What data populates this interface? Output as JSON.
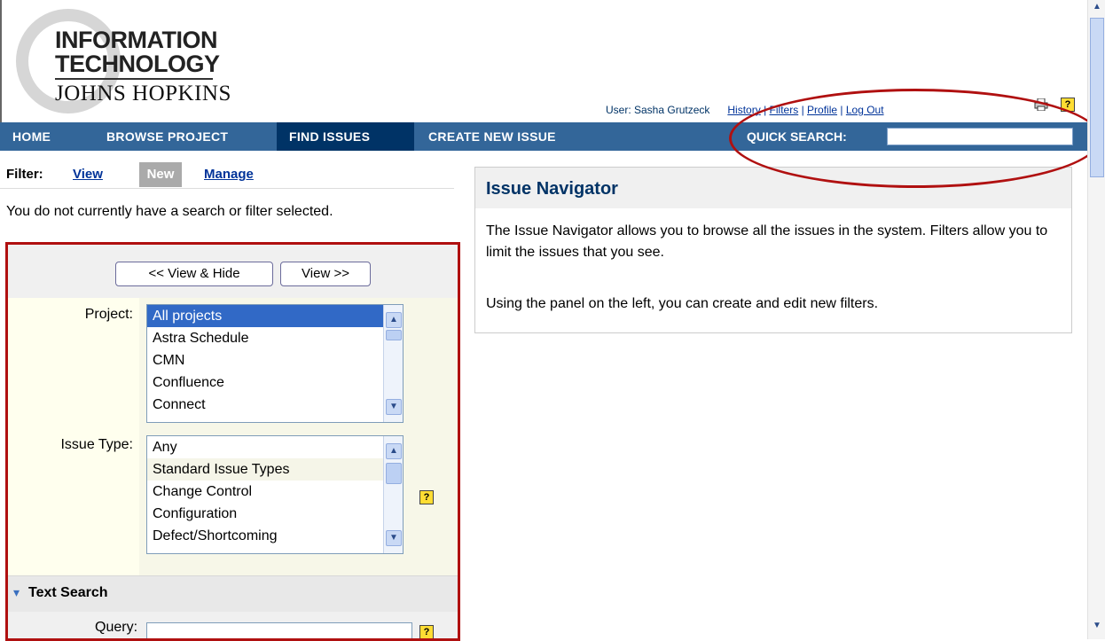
{
  "logo": {
    "line1": "INFORMATION",
    "line2": "TECHNOLOGY",
    "line3": "JOHNS HOPKINS"
  },
  "user_bar": {
    "user_text": "User: Sasha Grutzeck",
    "links": [
      "History",
      "Filters",
      "Profile",
      "Log Out"
    ],
    "sep": "|"
  },
  "nav": {
    "items": [
      "HOME",
      "BROWSE PROJECT",
      "FIND ISSUES",
      "CREATE NEW ISSUE"
    ],
    "active": "FIND ISSUES",
    "quick_search_label": "QUICK SEARCH:",
    "quick_search_value": ""
  },
  "filter": {
    "label": "Filter:",
    "view": "View",
    "new": "New",
    "manage": "Manage",
    "message": "You do not currently have a search or filter selected."
  },
  "panel": {
    "view_hide_button": "<< View & Hide",
    "view_button": "View >>",
    "project_label": "Project:",
    "project_options": [
      "All projects",
      "Astra Schedule",
      "CMN",
      "Confluence",
      "Connect"
    ],
    "issue_type_label": "Issue Type:",
    "issue_type_options": [
      "Any",
      "Standard Issue Types",
      "Change Control",
      "Configuration",
      "Defect/Shortcoming"
    ],
    "text_search_heading": "Text Search",
    "query_label": "Query:",
    "query_value": ""
  },
  "navigator": {
    "title": "Issue Navigator",
    "paragraph1": "The Issue Navigator allows you to browse all the issues in the system. Filters allow you to limit the issues that you see.",
    "paragraph2": "Using the panel on the left, you can create and edit new filters."
  },
  "icons": {
    "help": "?",
    "chevron": "▾",
    "scroll_up": "▲",
    "scroll_down": "▼"
  },
  "colors": {
    "nav_bg": "#336699",
    "nav_active": "#003366",
    "annotation": "#b01010",
    "link": "#003399"
  }
}
